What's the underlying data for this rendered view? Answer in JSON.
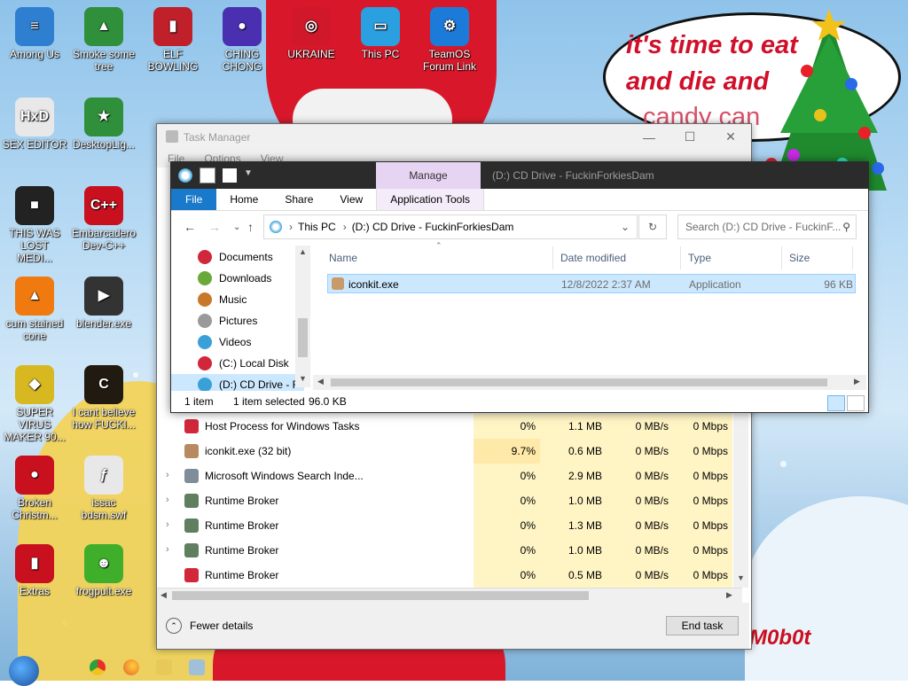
{
  "wallpaper": {
    "speech_lines": [
      "it's time to eat",
      "and die and",
      "candy can"
    ],
    "signature": "M0b0t"
  },
  "desktop_icons": [
    {
      "label": "Among Us",
      "color": "#2f7fd0",
      "glyph": "≡"
    },
    {
      "label": "Smoke some tree",
      "color": "#2f8f3a",
      "glyph": "▲"
    },
    {
      "label": "ELF BOWLING",
      "color": "#c0202a",
      "glyph": "▮"
    },
    {
      "label": "CHING CHONG",
      "color": "#4a2fb0",
      "glyph": "●"
    },
    {
      "label": "UKRAINE",
      "color": "#d0182a",
      "glyph": "◎"
    },
    {
      "label": "This PC",
      "color": "#2aa0e0",
      "glyph": "▭"
    },
    {
      "label": "TeamOS Forum Link",
      "color": "#1c7bd8",
      "glyph": "⚙"
    },
    {
      "label": "SEX EDITOR",
      "color": "#e8e8e8",
      "glyph": "HxD"
    },
    {
      "label": "DesktopLig...",
      "color": "#2f8f3a",
      "glyph": "★"
    },
    {
      "label": "THIS WAS LOST MEDI...",
      "color": "#222222",
      "glyph": "■"
    },
    {
      "label": "Embarcadero Dev-C++",
      "color": "#c8101e",
      "glyph": "C++"
    },
    {
      "label": "cum stained cone",
      "color": "#f07a10",
      "glyph": "▲"
    },
    {
      "label": "blender.exe",
      "color": "#333333",
      "glyph": "▶"
    },
    {
      "label": "SUPER VIRUS MAKER 90...",
      "color": "#d8b820",
      "glyph": "◆"
    },
    {
      "label": "I cant believe how FUCKI...",
      "color": "#201a10",
      "glyph": "C"
    },
    {
      "label": "Broken Christm...",
      "color": "#c8101e",
      "glyph": "●"
    },
    {
      "label": "issac bdsm.swf",
      "color": "#e8e8e8",
      "glyph": "ƒ"
    },
    {
      "label": "Extras",
      "color": "#c8101e",
      "glyph": "▮"
    },
    {
      "label": "frogpult.exe",
      "color": "#3fae2a",
      "glyph": "☻"
    }
  ],
  "task_manager": {
    "title": "Task Manager",
    "menu": [
      "File",
      "Options",
      "View"
    ],
    "processes": [
      {
        "name": "Host Process for Windows Tasks",
        "cpu": "0%",
        "memory": "1.1 MB",
        "disk": "0 MB/s",
        "network": "0 Mbps",
        "expandable": false,
        "icon_color": "#d0283a"
      },
      {
        "name": "iconkit.exe (32 bit)",
        "cpu": "9.7%",
        "memory": "0.6 MB",
        "disk": "0 MB/s",
        "network": "0 Mbps",
        "expandable": false,
        "icon_color": "#b88a60"
      },
      {
        "name": "Microsoft Windows Search Inde...",
        "cpu": "0%",
        "memory": "2.9 MB",
        "disk": "0 MB/s",
        "network": "0 Mbps",
        "expandable": true,
        "icon_color": "#7f8c99"
      },
      {
        "name": "Runtime Broker",
        "cpu": "0%",
        "memory": "1.0 MB",
        "disk": "0 MB/s",
        "network": "0 Mbps",
        "expandable": true,
        "icon_color": "#5f7f5f"
      },
      {
        "name": "Runtime Broker",
        "cpu": "0%",
        "memory": "1.3 MB",
        "disk": "0 MB/s",
        "network": "0 Mbps",
        "expandable": true,
        "icon_color": "#5f7f5f"
      },
      {
        "name": "Runtime Broker",
        "cpu": "0%",
        "memory": "1.0 MB",
        "disk": "0 MB/s",
        "network": "0 Mbps",
        "expandable": true,
        "icon_color": "#5f7f5f"
      },
      {
        "name": "Runtime Broker",
        "cpu": "0%",
        "memory": "0.5 MB",
        "disk": "0 MB/s",
        "network": "0 Mbps",
        "expandable": false,
        "icon_color": "#d0283a"
      }
    ],
    "fewer_details": "Fewer details",
    "end_task": "End task"
  },
  "explorer": {
    "context_tab": "Manage",
    "window_title": "(D:) CD Drive - FuckinForkiesDam",
    "ribbon_tabs": [
      "File",
      "Home",
      "Share",
      "View",
      "Application Tools"
    ],
    "breadcrumb": [
      "This PC",
      "(D:) CD Drive - FuckinForkiesDam"
    ],
    "search_placeholder": "Search (D:) CD Drive - FuckinF...",
    "nav_items": [
      {
        "label": "Documents",
        "color": "#d0283a"
      },
      {
        "label": "Downloads",
        "color": "#6aa83a"
      },
      {
        "label": "Music",
        "color": "#c8782a"
      },
      {
        "label": "Pictures",
        "color": "#9a9a9a"
      },
      {
        "label": "Videos",
        "color": "#3aa0d8"
      },
      {
        "label": "(C:) Local Disk",
        "color": "#d0283a"
      },
      {
        "label": "(D:) CD Drive - F",
        "color": "#3aa0d8"
      }
    ],
    "columns": [
      "Name",
      "Date modified",
      "Type",
      "Size"
    ],
    "files": [
      {
        "name": "iconkit.exe",
        "date": "12/8/2022 2:37 AM",
        "type": "Application",
        "size": "96 KB"
      }
    ],
    "status": {
      "count": "1 item",
      "selection": "1 item selected",
      "size": "96.0 KB"
    }
  }
}
